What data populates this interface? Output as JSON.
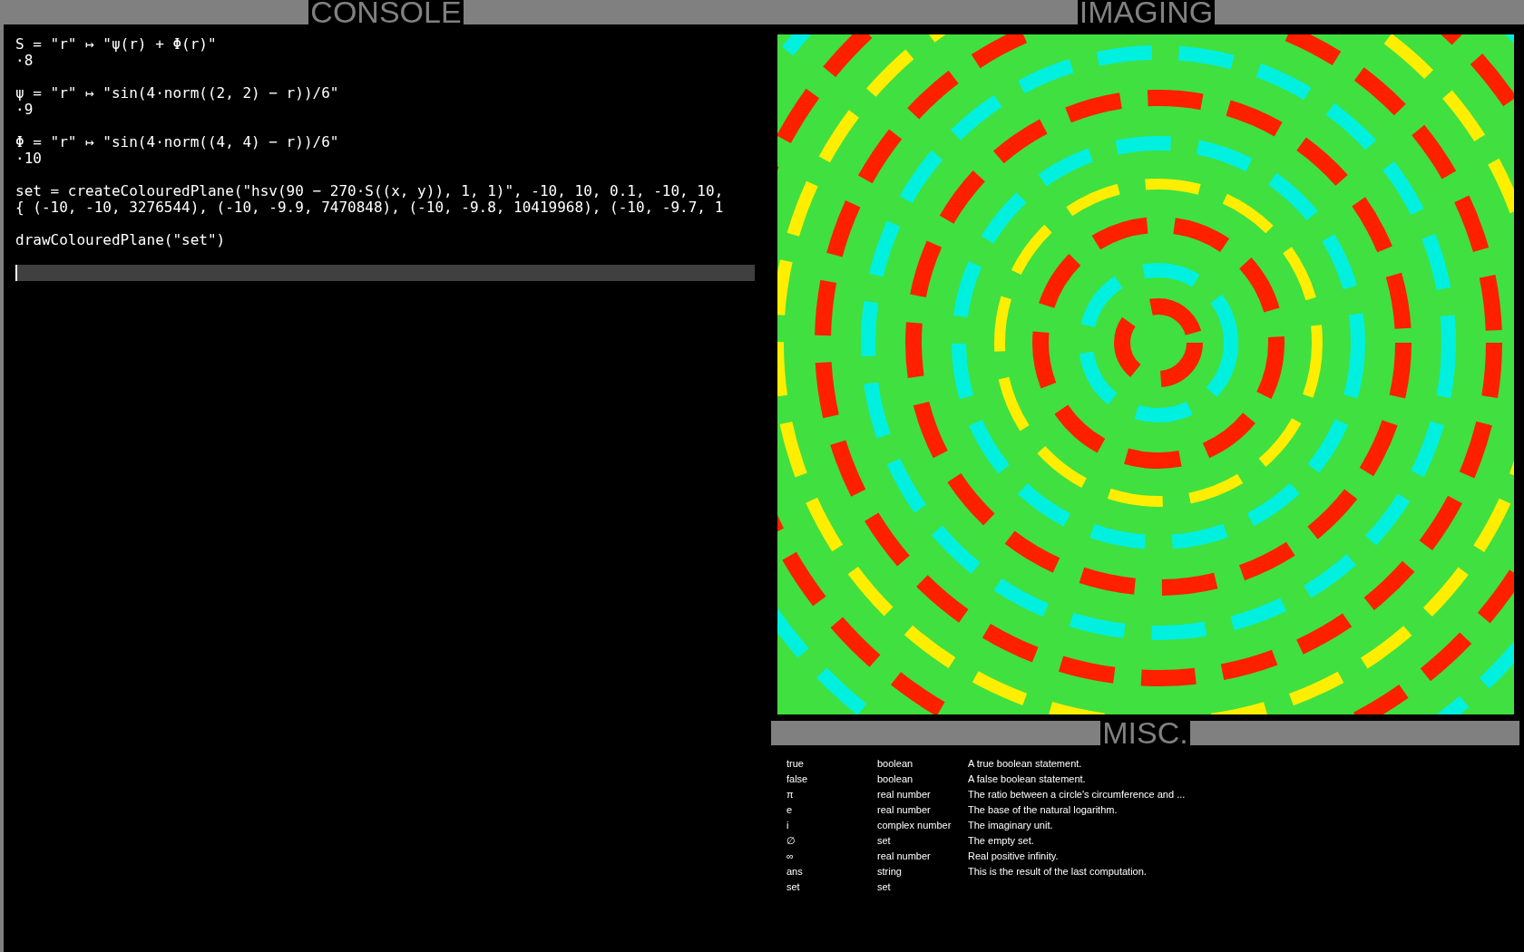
{
  "console": {
    "title": "CONSOLE",
    "entries": [
      {
        "input": "S = \"r\" ↦ \"ψ(r) + Φ(r)\"",
        "output": "·8"
      },
      {
        "input": "ψ = \"r\" ↦ \"sin(4·norm((2, 2) − r))/6\"",
        "output": "·9"
      },
      {
        "input": "Φ = \"r\" ↦ \"sin(4·norm((4, 4) − r))/6\"",
        "output": "·10"
      },
      {
        "input": "set = createColouredPlane(\"hsv(90 − 270·S((x, y)), 1, 1)\", -10, 10, 0.1, -10, 10,",
        "output": "{ (-10, -10, 3276544), (-10, -9.9, 7470848), (-10, -9.8, 10419968), (-10, -9.7, 1"
      },
      {
        "input": "drawColouredPlane(\"set\")"
      }
    ]
  },
  "imaging": {
    "title": "IMAGING"
  },
  "misc": {
    "title": "MISC.",
    "rows": [
      {
        "name": "true",
        "type": "boolean",
        "description": "A true boolean statement."
      },
      {
        "name": "false",
        "type": "boolean",
        "description": "A false boolean statement."
      },
      {
        "name": "π",
        "type": "real number",
        "description": "The ratio between a circle's circumference and ..."
      },
      {
        "name": "e",
        "type": "real number",
        "description": "The base of the natural logarithm."
      },
      {
        "name": "i",
        "type": "complex number",
        "description": "The imaginary unit."
      },
      {
        "name": "∅",
        "type": "set",
        "description": "The empty set."
      },
      {
        "name": "∞",
        "type": "real number",
        "description": "Real positive infinity."
      },
      {
        "name": "ans",
        "type": "string",
        "description": "This is the result of the last computation."
      },
      {
        "name": "set",
        "type": "set"
      }
    ]
  }
}
